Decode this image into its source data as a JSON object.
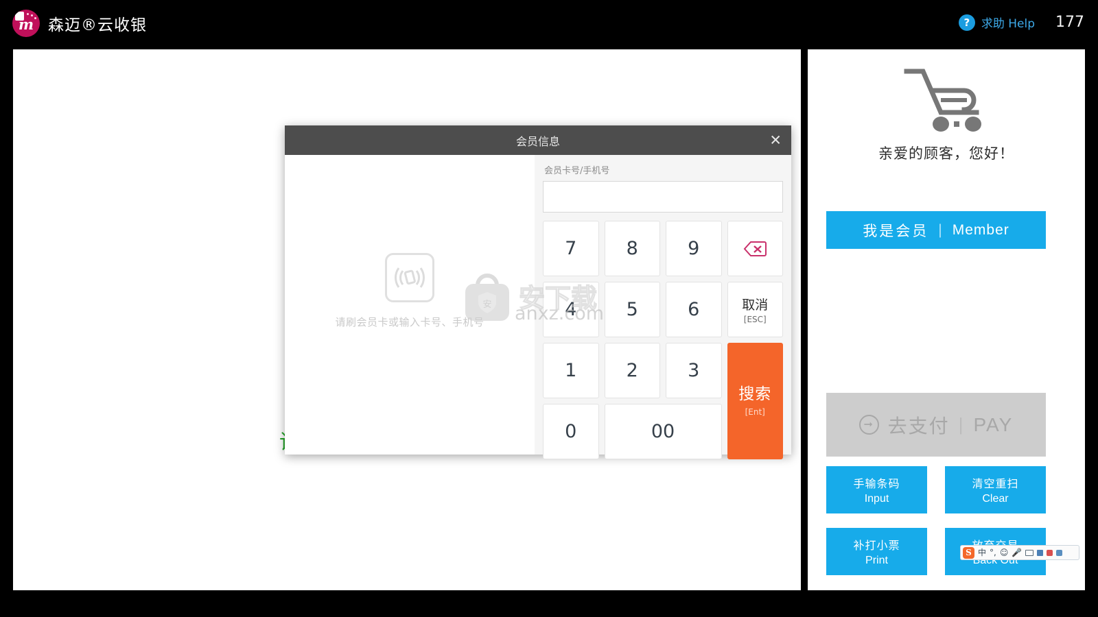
{
  "topbar": {
    "brand_name": "森迈®云收银",
    "logo_icon": "brand-logo-icon",
    "help_icon": "question-mark-icon",
    "help_label": "求助 Help",
    "counter": "177"
  },
  "main": {
    "green_hint": "请"
  },
  "sidebar": {
    "cart_icon": "shopping-cart-icon",
    "greeting": "亲爱的顾客，您好！",
    "member_button": {
      "zh": "我是会员",
      "separator": "|",
      "en": "Member"
    },
    "pay_button": {
      "arrow_icon": "arrow-right-circle-icon",
      "zh": "去支付",
      "separator": "|",
      "en": "PAY"
    },
    "quick_buttons": [
      {
        "zh": "手输条码",
        "en": "Input"
      },
      {
        "zh": "清空重扫",
        "en": "Clear"
      },
      {
        "zh": "补打小票",
        "en": "Print"
      },
      {
        "zh": "放弃交易",
        "en": "Back Out"
      }
    ]
  },
  "modal": {
    "title": "会员信息",
    "close_icon": "close-icon",
    "card_icon": "contactless-card-icon",
    "card_hint": "请刷会员卡或输入卡号、手机号",
    "field_label": "会员卡号/手机号",
    "field_value": "",
    "field_placeholder": "",
    "keys": {
      "k7": "7",
      "k8": "8",
      "k9": "9",
      "backspace_icon": "backspace-delete-icon",
      "k4": "4",
      "k5": "5",
      "k6": "6",
      "cancel_zh": "取消",
      "cancel_key": "[ESC]",
      "k1": "1",
      "k2": "2",
      "k3": "3",
      "search_zh": "搜索",
      "search_key": "[Ent]",
      "k0": "0",
      "k00": "00"
    }
  },
  "watermark": {
    "bag_icon": "shield-bag-watermark-icon",
    "zh": "安下载",
    "url": "anxz.com"
  },
  "ime": {
    "logo": "S",
    "mode": "中",
    "punct": "°,",
    "emoji_icon": "smiley-icon",
    "voice_icon": "microphone-icon",
    "keyboard_icon": "keyboard-icon",
    "user_icon": "user-icon",
    "toolbox_icon": "toolbox-icon",
    "grid_icon": "grid-icon"
  },
  "colors": {
    "brand_pink": "#c0105a",
    "accent_blue": "#17abea",
    "help_blue": "#3da9e8",
    "orange": "#f4652a",
    "green": "#25a52a",
    "disabled_grey": "#cdcdcd",
    "modal_header": "#4d4d4d"
  }
}
